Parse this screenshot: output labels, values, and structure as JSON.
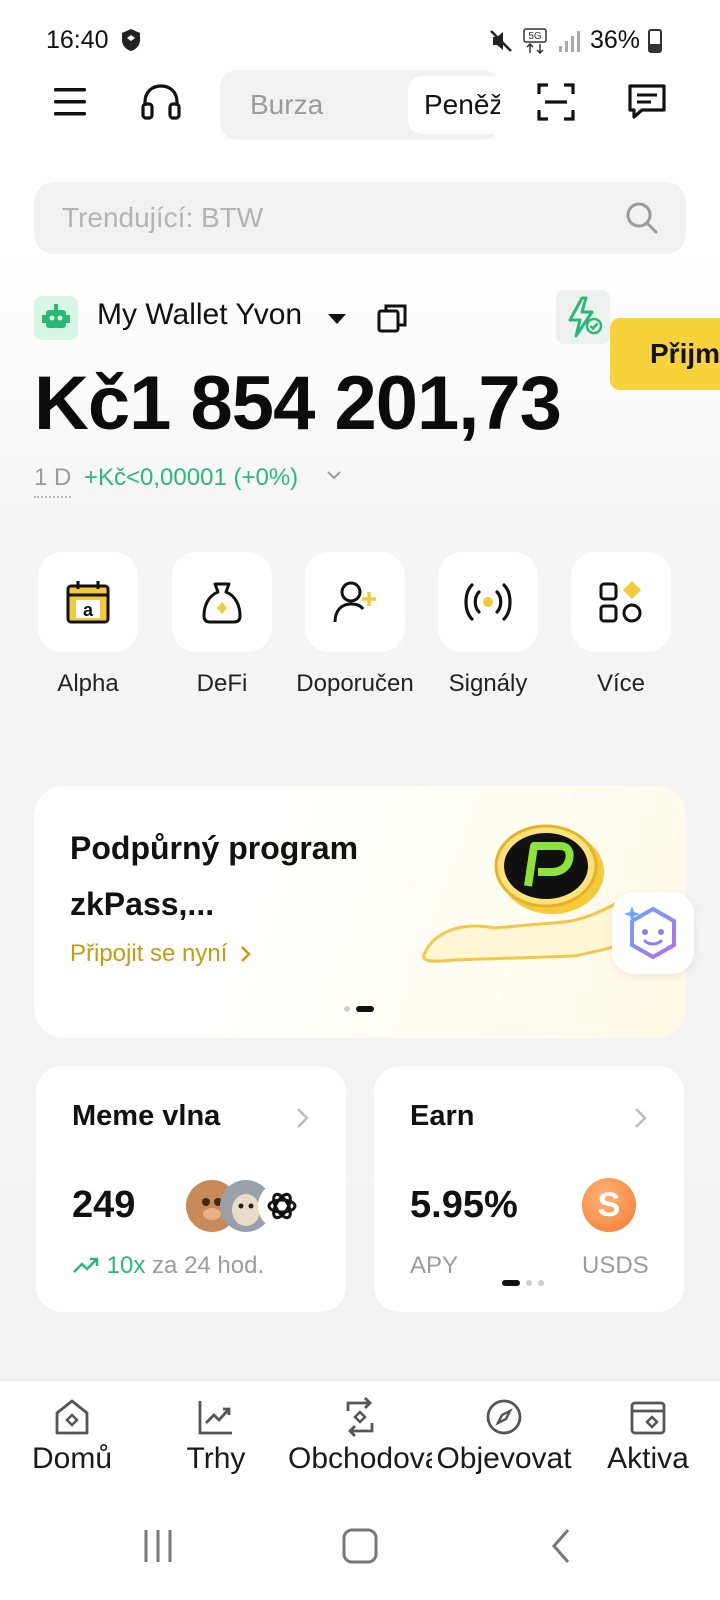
{
  "status_bar": {
    "time": "16:40",
    "battery": "36%",
    "icons": [
      "shield-icon",
      "mute-icon",
      "5g-icon",
      "signal-icon",
      "battery-icon"
    ]
  },
  "header": {
    "tabs": [
      "Burza",
      "Peněž"
    ],
    "icons": [
      "menu-icon",
      "headset-icon",
      "scan-icon",
      "message-icon"
    ]
  },
  "search": {
    "placeholder": "Trendující: BTW"
  },
  "wallet": {
    "name": "My Wallet Yvon",
    "balance": "Kč1 854 201,73",
    "period": "1 D",
    "change": "+Kč<0,00001 (+0%)",
    "receive_label": "Přijm"
  },
  "shortcuts": [
    {
      "label": "Alpha",
      "icon": "alpha-calendar-icon"
    },
    {
      "label": "DeFi",
      "icon": "defi-bag-icon"
    },
    {
      "label": "Doporučen",
      "icon": "add-user-icon"
    },
    {
      "label": "Signály",
      "icon": "signal-broadcast-icon"
    },
    {
      "label": "Více",
      "icon": "more-grid-icon"
    }
  ],
  "banner": {
    "title": "Podpůrný program zkPass,...",
    "link": "Připojit se nyní"
  },
  "cards": {
    "meme": {
      "title": "Meme vlna",
      "value": "249",
      "multiplier": "10x",
      "sub": "za 24 hod."
    },
    "earn": {
      "title": "Earn",
      "value": "5.95%",
      "label": "APY",
      "token": "USDS"
    }
  },
  "bottom_nav": [
    {
      "label": "Domů",
      "icon": "home-icon"
    },
    {
      "label": "Trhy",
      "icon": "markets-icon"
    },
    {
      "label": "Obchodovat",
      "icon": "trade-icon"
    },
    {
      "label": "Objevovat",
      "icon": "discover-icon"
    },
    {
      "label": "Aktiva",
      "icon": "assets-icon"
    }
  ],
  "colors": {
    "accent_yellow": "#f7d23a",
    "positive_green": "#2ab77a",
    "link_gold": "#c99a14"
  }
}
